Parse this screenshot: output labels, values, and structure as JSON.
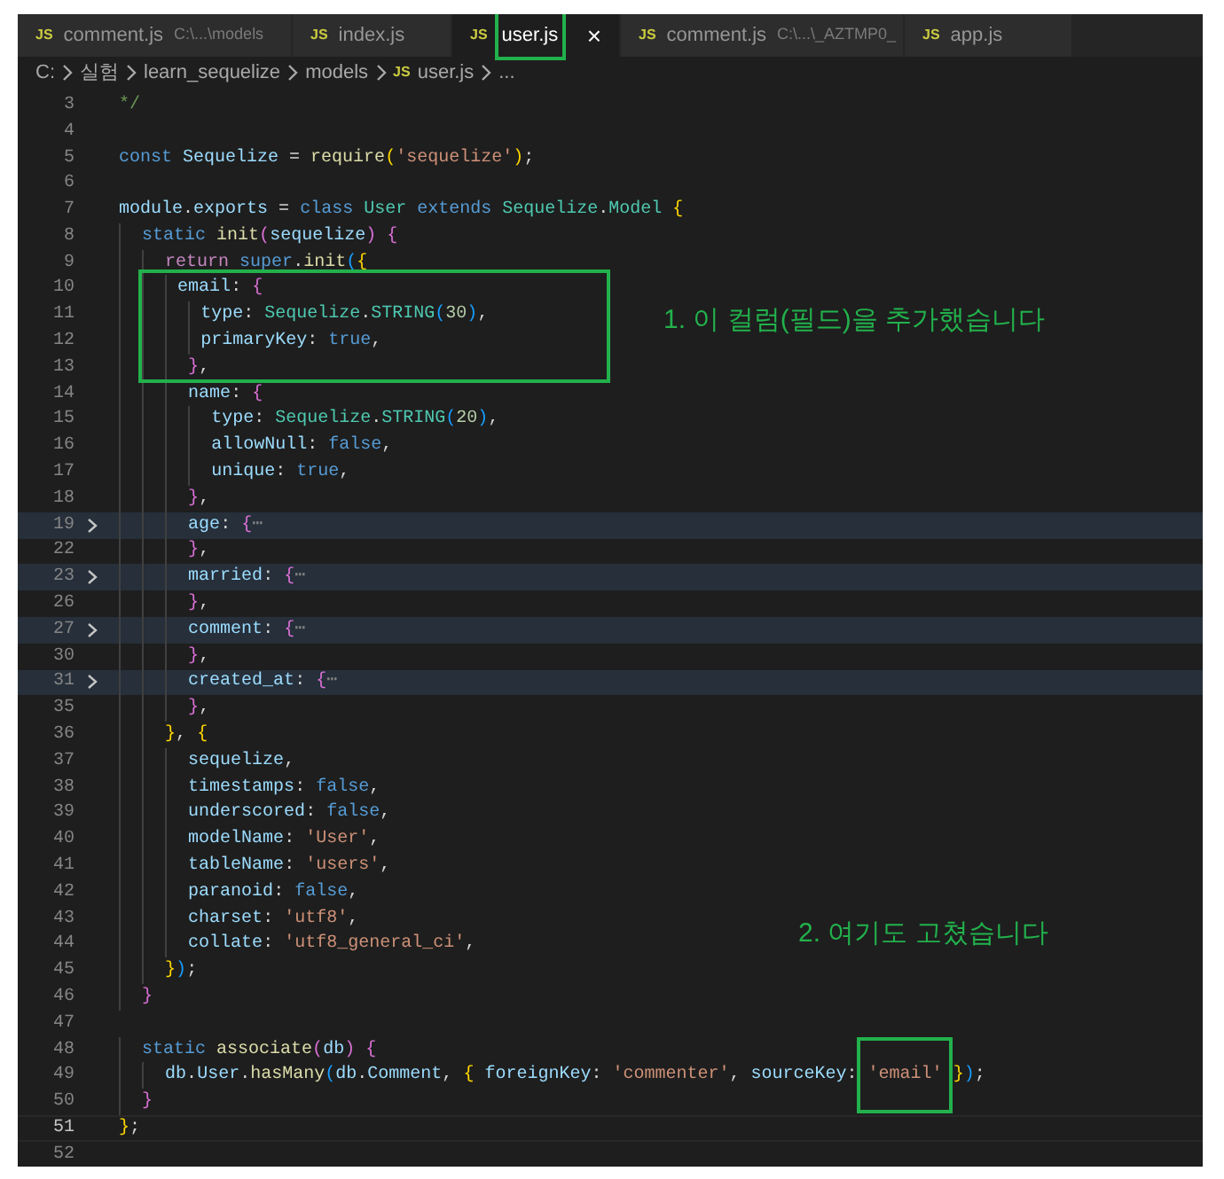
{
  "tabs": [
    {
      "icon": "JS",
      "label": "comment.js",
      "path": "C:\\...\\models",
      "selected": false,
      "boxed": false
    },
    {
      "icon": "JS",
      "label": "index.js",
      "selected": false,
      "boxed": false
    },
    {
      "icon": "JS",
      "label": "user.js",
      "selected": true,
      "boxed": true,
      "close": "×"
    },
    {
      "icon": "JS",
      "label": "comment.js",
      "path": "C:\\...\\_AZTMP0_",
      "selected": false,
      "boxed": false
    },
    {
      "icon": "JS",
      "label": "app.js",
      "selected": false,
      "boxed": false
    }
  ],
  "breadcrumb": [
    {
      "text": "C:"
    },
    {
      "text": "실험"
    },
    {
      "text": "learn_sequelize"
    },
    {
      "text": "models"
    },
    {
      "icon": "JS",
      "text": "user.js"
    },
    {
      "text": "..."
    }
  ],
  "lines": [
    {
      "number": "3",
      "folded": false,
      "current": false,
      "boxed": false,
      "tokens": [
        {
          "kind": "comment",
          "text": "*/"
        }
      ]
    },
    {
      "number": "4",
      "folded": false,
      "current": false,
      "boxed": false
    },
    {
      "number": "5",
      "folded": false,
      "current": false,
      "boxed": false,
      "tokens": [
        {
          "kind": "keyword",
          "text": "const "
        },
        {
          "kind": "variable",
          "text": "Sequelize"
        },
        {
          "kind": "plain",
          "text": " = "
        },
        {
          "kind": "function",
          "text": "require"
        },
        {
          "kind": "bracket1",
          "text": "("
        },
        {
          "kind": "string",
          "text": "'sequelize'"
        },
        {
          "kind": "bracket1",
          "text": ")"
        },
        {
          "kind": "plain",
          "text": ";"
        }
      ]
    },
    {
      "number": "6",
      "folded": false,
      "current": false,
      "boxed": false
    },
    {
      "number": "7",
      "folded": false,
      "current": false,
      "boxed": false,
      "tokens": [
        {
          "kind": "variable",
          "text": "module"
        },
        {
          "kind": "plain",
          "text": "."
        },
        {
          "kind": "variable",
          "text": "exports"
        },
        {
          "kind": "plain",
          "text": " = "
        },
        {
          "kind": "keyword",
          "text": "class "
        },
        {
          "kind": "class",
          "text": "User "
        },
        {
          "kind": "keyword",
          "text": "extends "
        },
        {
          "kind": "class",
          "text": "Sequelize"
        },
        {
          "kind": "plain",
          "text": "."
        },
        {
          "kind": "class",
          "text": "Model "
        },
        {
          "kind": "bracket1",
          "text": "{"
        }
      ]
    },
    {
      "number": "8",
      "folded": false,
      "current": false,
      "boxed": false,
      "tokens": [
        {
          "kind": "keyword",
          "text": "  static "
        },
        {
          "kind": "function",
          "text": "init"
        },
        {
          "kind": "bracket2",
          "text": "("
        },
        {
          "kind": "variable",
          "text": "sequelize"
        },
        {
          "kind": "bracket2",
          "text": ") {"
        }
      ]
    },
    {
      "number": "9",
      "folded": false,
      "current": false,
      "boxed": false,
      "tokens": [
        {
          "kind": "control",
          "text": "    return "
        },
        {
          "kind": "keyword",
          "text": "super"
        },
        {
          "kind": "plain",
          "text": "."
        },
        {
          "kind": "function",
          "text": "init"
        },
        {
          "kind": "bracket3",
          "text": "("
        },
        {
          "kind": "bracket1",
          "text": "{"
        }
      ]
    },
    {
      "number": "10",
      "folded": false,
      "current": false,
      "boxed": true,
      "tokens": [
        {
          "kind": "variable",
          "text": "     email"
        },
        {
          "kind": "plain",
          "text": ": "
        },
        {
          "kind": "bracket2",
          "text": "{"
        }
      ]
    },
    {
      "number": "11",
      "folded": false,
      "current": false,
      "boxed": true,
      "tokens": [
        {
          "kind": "variable",
          "text": "       type"
        },
        {
          "kind": "plain",
          "text": ": "
        },
        {
          "kind": "class",
          "text": "Sequelize"
        },
        {
          "kind": "plain",
          "text": "."
        },
        {
          "kind": "class",
          "text": "STRING"
        },
        {
          "kind": "bracket3",
          "text": "("
        },
        {
          "kind": "number",
          "text": "30"
        },
        {
          "kind": "bracket3",
          "text": ")"
        },
        {
          "kind": "plain",
          "text": ","
        }
      ]
    },
    {
      "number": "12",
      "folded": false,
      "current": false,
      "boxed": true,
      "tokens": [
        {
          "kind": "variable",
          "text": "       primaryKey"
        },
        {
          "kind": "plain",
          "text": ": "
        },
        {
          "kind": "keyword",
          "text": "true"
        },
        {
          "kind": "plain",
          "text": ","
        }
      ]
    },
    {
      "number": "13",
      "folded": false,
      "current": false,
      "boxed": true,
      "tokens": [
        {
          "kind": "bracket2",
          "text": "      }"
        },
        {
          "kind": "plain",
          "text": ","
        }
      ]
    },
    {
      "number": "14",
      "folded": false,
      "current": false,
      "boxed": false,
      "tokens": [
        {
          "kind": "variable",
          "text": "      name"
        },
        {
          "kind": "plain",
          "text": ": "
        },
        {
          "kind": "bracket2",
          "text": "{"
        }
      ]
    },
    {
      "number": "15",
      "folded": false,
      "current": false,
      "boxed": false,
      "tokens": [
        {
          "kind": "variable",
          "text": "        type"
        },
        {
          "kind": "plain",
          "text": ": "
        },
        {
          "kind": "class",
          "text": "Sequelize"
        },
        {
          "kind": "plain",
          "text": "."
        },
        {
          "kind": "class",
          "text": "STRING"
        },
        {
          "kind": "bracket3",
          "text": "("
        },
        {
          "kind": "number",
          "text": "20"
        },
        {
          "kind": "bracket3",
          "text": ")"
        },
        {
          "kind": "plain",
          "text": ","
        }
      ]
    },
    {
      "number": "16",
      "folded": false,
      "current": false,
      "boxed": false,
      "tokens": [
        {
          "kind": "variable",
          "text": "        allowNull"
        },
        {
          "kind": "plain",
          "text": ": "
        },
        {
          "kind": "keyword",
          "text": "false"
        },
        {
          "kind": "plain",
          "text": ","
        }
      ]
    },
    {
      "number": "17",
      "folded": false,
      "current": false,
      "boxed": false,
      "tokens": [
        {
          "kind": "variable",
          "text": "        unique"
        },
        {
          "kind": "plain",
          "text": ": "
        },
        {
          "kind": "keyword",
          "text": "true"
        },
        {
          "kind": "plain",
          "text": ","
        }
      ]
    },
    {
      "number": "18",
      "folded": false,
      "current": false,
      "boxed": false,
      "tokens": [
        {
          "kind": "bracket2",
          "text": "      }"
        },
        {
          "kind": "plain",
          "text": ","
        }
      ]
    },
    {
      "number": "19",
      "folded": true,
      "current": false,
      "boxed": false,
      "tokens": [
        {
          "kind": "variable",
          "text": "      age"
        },
        {
          "kind": "plain",
          "text": ": "
        },
        {
          "kind": "bracket2",
          "text": "{"
        },
        {
          "kind": "fold",
          "text": "⋯"
        }
      ]
    },
    {
      "number": "22",
      "folded": false,
      "current": false,
      "boxed": false,
      "tokens": [
        {
          "kind": "bracket2",
          "text": "      }"
        },
        {
          "kind": "plain",
          "text": ","
        }
      ]
    },
    {
      "number": "23",
      "folded": true,
      "current": false,
      "boxed": false,
      "tokens": [
        {
          "kind": "variable",
          "text": "      married"
        },
        {
          "kind": "plain",
          "text": ": "
        },
        {
          "kind": "bracket2",
          "text": "{"
        },
        {
          "kind": "fold",
          "text": "⋯"
        }
      ]
    },
    {
      "number": "26",
      "folded": false,
      "current": false,
      "boxed": false,
      "tokens": [
        {
          "kind": "bracket2",
          "text": "      }"
        },
        {
          "kind": "plain",
          "text": ","
        }
      ]
    },
    {
      "number": "27",
      "folded": true,
      "current": false,
      "boxed": false,
      "tokens": [
        {
          "kind": "variable",
          "text": "      comment"
        },
        {
          "kind": "plain",
          "text": ": "
        },
        {
          "kind": "bracket2",
          "text": "{"
        },
        {
          "kind": "fold",
          "text": "⋯"
        }
      ]
    },
    {
      "number": "30",
      "folded": false,
      "current": false,
      "boxed": false,
      "tokens": [
        {
          "kind": "bracket2",
          "text": "      }"
        },
        {
          "kind": "plain",
          "text": ","
        }
      ]
    },
    {
      "number": "31",
      "folded": true,
      "current": false,
      "boxed": false,
      "tokens": [
        {
          "kind": "variable",
          "text": "      created_at"
        },
        {
          "kind": "plain",
          "text": ": "
        },
        {
          "kind": "bracket2",
          "text": "{"
        },
        {
          "kind": "fold",
          "text": "⋯"
        }
      ]
    },
    {
      "number": "35",
      "folded": false,
      "current": false,
      "boxed": false,
      "tokens": [
        {
          "kind": "bracket2",
          "text": "      }"
        },
        {
          "kind": "plain",
          "text": ","
        }
      ]
    },
    {
      "number": "36",
      "folded": false,
      "current": false,
      "boxed": false,
      "tokens": [
        {
          "kind": "bracket1",
          "text": "    }"
        },
        {
          "kind": "plain",
          "text": ", "
        },
        {
          "kind": "bracket1",
          "text": "{"
        }
      ]
    },
    {
      "number": "37",
      "folded": false,
      "current": false,
      "boxed": false,
      "tokens": [
        {
          "kind": "variable",
          "text": "      sequelize"
        },
        {
          "kind": "plain",
          "text": ","
        }
      ]
    },
    {
      "number": "38",
      "folded": false,
      "current": false,
      "boxed": false,
      "tokens": [
        {
          "kind": "variable",
          "text": "      timestamps"
        },
        {
          "kind": "plain",
          "text": ": "
        },
        {
          "kind": "keyword",
          "text": "false"
        },
        {
          "kind": "plain",
          "text": ","
        }
      ]
    },
    {
      "number": "39",
      "folded": false,
      "current": false,
      "boxed": false,
      "tokens": [
        {
          "kind": "variable",
          "text": "      underscored"
        },
        {
          "kind": "plain",
          "text": ": "
        },
        {
          "kind": "keyword",
          "text": "false"
        },
        {
          "kind": "plain",
          "text": ","
        }
      ]
    },
    {
      "number": "40",
      "folded": false,
      "current": false,
      "boxed": false,
      "tokens": [
        {
          "kind": "variable",
          "text": "      modelName"
        },
        {
          "kind": "plain",
          "text": ": "
        },
        {
          "kind": "string",
          "text": "'User'"
        },
        {
          "kind": "plain",
          "text": ","
        }
      ]
    },
    {
      "number": "41",
      "folded": false,
      "current": false,
      "boxed": false,
      "tokens": [
        {
          "kind": "variable",
          "text": "      tableName"
        },
        {
          "kind": "plain",
          "text": ": "
        },
        {
          "kind": "string",
          "text": "'users'"
        },
        {
          "kind": "plain",
          "text": ","
        }
      ]
    },
    {
      "number": "42",
      "folded": false,
      "current": false,
      "boxed": false,
      "tokens": [
        {
          "kind": "variable",
          "text": "      paranoid"
        },
        {
          "kind": "plain",
          "text": ": "
        },
        {
          "kind": "keyword",
          "text": "false"
        },
        {
          "kind": "plain",
          "text": ","
        }
      ]
    },
    {
      "number": "43",
      "folded": false,
      "current": false,
      "boxed": false,
      "tokens": [
        {
          "kind": "variable",
          "text": "      charset"
        },
        {
          "kind": "plain",
          "text": ": "
        },
        {
          "kind": "string",
          "text": "'utf8'"
        },
        {
          "kind": "plain",
          "text": ","
        }
      ]
    },
    {
      "number": "44",
      "folded": false,
      "current": false,
      "boxed": false,
      "tokens": [
        {
          "kind": "variable",
          "text": "      collate"
        },
        {
          "kind": "plain",
          "text": ": "
        },
        {
          "kind": "string",
          "text": "'utf8_general_ci'"
        },
        {
          "kind": "plain",
          "text": ","
        }
      ]
    },
    {
      "number": "45",
      "folded": false,
      "current": false,
      "boxed": false,
      "tokens": [
        {
          "kind": "bracket1",
          "text": "    }"
        },
        {
          "kind": "bracket3",
          "text": ")"
        },
        {
          "kind": "plain",
          "text": ";"
        }
      ]
    },
    {
      "number": "46",
      "folded": false,
      "current": false,
      "boxed": false,
      "tokens": [
        {
          "kind": "bracket2",
          "text": "  }"
        }
      ]
    },
    {
      "number": "47",
      "folded": false,
      "current": false,
      "boxed": false
    },
    {
      "number": "48",
      "folded": false,
      "current": false,
      "boxed": false,
      "tokens": [
        {
          "kind": "keyword",
          "text": "  static "
        },
        {
          "kind": "function",
          "text": "associate"
        },
        {
          "kind": "bracket2",
          "text": "("
        },
        {
          "kind": "variable",
          "text": "db"
        },
        {
          "kind": "bracket2",
          "text": ") {"
        }
      ]
    },
    {
      "number": "49",
      "folded": false,
      "current": false,
      "boxed": false,
      "tokens": [
        {
          "kind": "variable",
          "text": "    db"
        },
        {
          "kind": "plain",
          "text": "."
        },
        {
          "kind": "variable",
          "text": "User"
        },
        {
          "kind": "plain",
          "text": "."
        },
        {
          "kind": "function",
          "text": "hasMany"
        },
        {
          "kind": "bracket3",
          "text": "("
        },
        {
          "kind": "variable",
          "text": "db"
        },
        {
          "kind": "plain",
          "text": "."
        },
        {
          "kind": "variable",
          "text": "Comment"
        },
        {
          "kind": "plain",
          "text": ", "
        },
        {
          "kind": "bracket1",
          "text": "{ "
        },
        {
          "kind": "variable",
          "text": "foreignKey"
        },
        {
          "kind": "plain",
          "text": ": "
        },
        {
          "kind": "string",
          "text": "'commenter'"
        },
        {
          "kind": "plain",
          "text": ", "
        },
        {
          "kind": "variable",
          "text": "sourceKey"
        },
        {
          "kind": "plain",
          "text": ": "
        },
        {
          "kind": "string",
          "text": "'email'",
          "boxed": true
        },
        {
          "kind": "bracket1",
          "text": " }"
        },
        {
          "kind": "bracket3",
          "text": ")"
        },
        {
          "kind": "plain",
          "text": ";"
        }
      ]
    },
    {
      "number": "50",
      "folded": false,
      "current": false,
      "boxed": false,
      "tokens": [
        {
          "kind": "bracket2",
          "text": "  }"
        }
      ]
    },
    {
      "number": "51",
      "folded": false,
      "current": true,
      "boxed": false,
      "tokens": [
        {
          "kind": "bracket1",
          "text": "}"
        },
        {
          "kind": "plain",
          "text": ";"
        }
      ]
    },
    {
      "number": "52",
      "folded": false,
      "current": false,
      "boxed": false
    }
  ],
  "annotations": [
    {
      "text": "1. 이 컬럼(필드)을 추가했습니다"
    },
    {
      "text": "2. 여기도 고쳤습니다"
    }
  ]
}
